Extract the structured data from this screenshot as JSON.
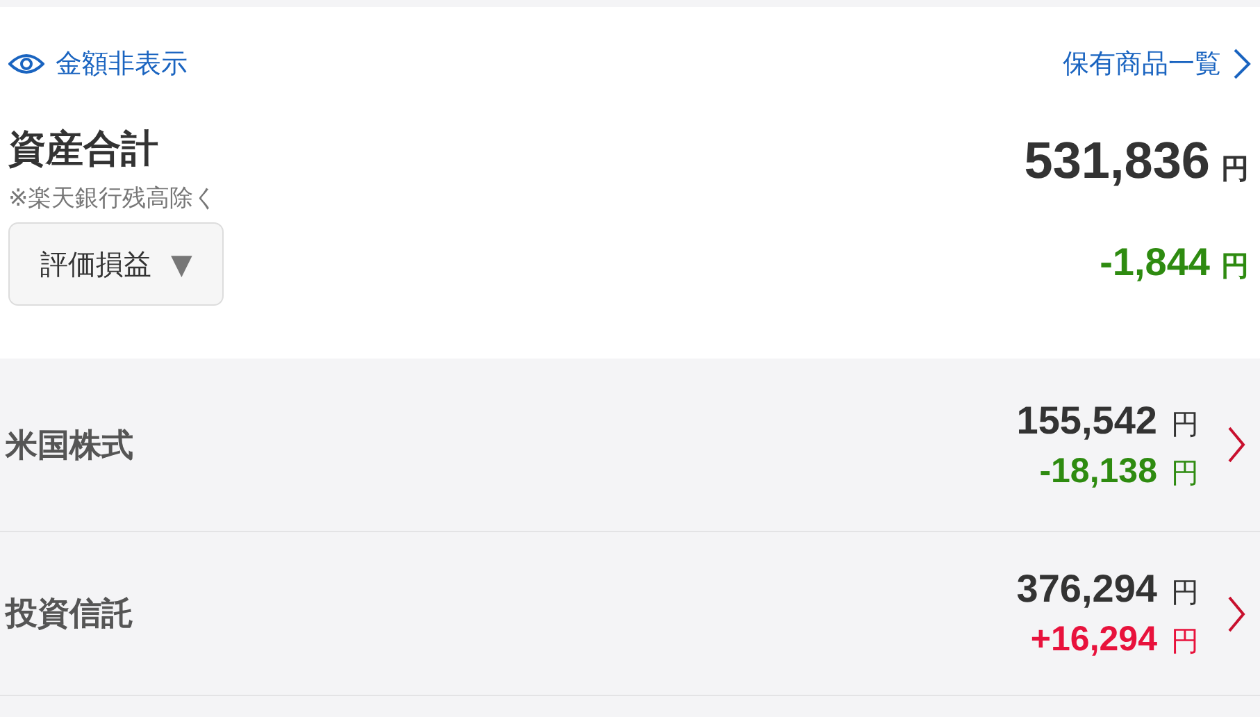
{
  "hide_amounts": {
    "label": "金額非表示"
  },
  "holdings_link": {
    "label": "保有商品一覧"
  },
  "total": {
    "title": "資産合計",
    "note": "※楽天銀行残高除く",
    "amount": "531,836",
    "unit": "円"
  },
  "metric_dropdown": {
    "label": "評価損益",
    "arrow": "▼"
  },
  "total_change": {
    "amount": "-1,844",
    "unit": "円",
    "color": "#2e8b10"
  },
  "categories": [
    {
      "name": "米国株式",
      "amount": "155,542",
      "unit": "円",
      "change": "-18,138",
      "change_unit": "円",
      "color": "#2e8b10"
    },
    {
      "name": "投資信託",
      "amount": "376,294",
      "unit": "円",
      "change": "+16,294",
      "change_unit": "円",
      "color": "#e8123c"
    }
  ]
}
